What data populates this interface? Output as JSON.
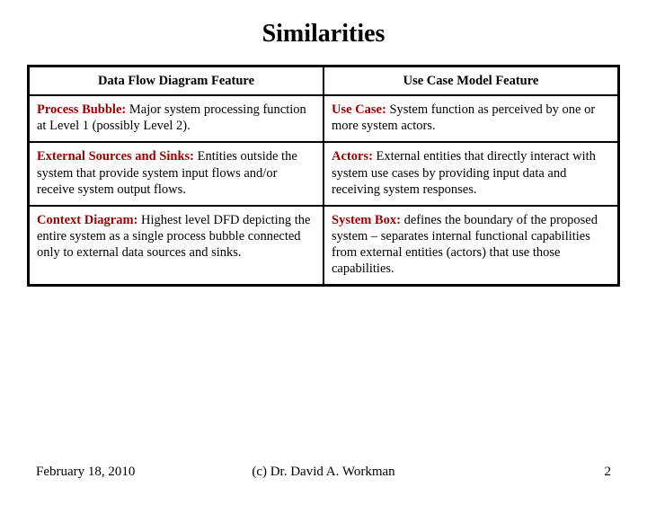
{
  "title": "Similarities",
  "headers": {
    "left": "Data Flow Diagram Feature",
    "right": "Use Case Model Feature"
  },
  "rows": [
    {
      "left_term": "Process Bubble:",
      "left_text": " Major system processing function at Level 1 (possibly Level 2).",
      "right_term": "Use Case:",
      "right_text": "  System function as perceived by one or more system actors."
    },
    {
      "left_term": "External Sources and Sinks:",
      "left_text": "  Entities outside the system that provide system input flows and/or receive system output flows.",
      "right_term": "Actors:",
      "right_text": "  External entities that directly interact with system use cases by providing input data and receiving system responses."
    },
    {
      "left_term": "Context Diagram:",
      "left_text": " Highest level DFD depicting the entire system as a single process bubble connected only to external data sources and sinks.",
      "right_term": "System Box:",
      "right_text": "  defines the boundary of the proposed system – separates internal functional capabilities from  external entities (actors) that use those capabilities."
    }
  ],
  "footer": {
    "date": "February 18, 2010",
    "copyright": "(c) Dr. David A. Workman",
    "page": "2"
  }
}
